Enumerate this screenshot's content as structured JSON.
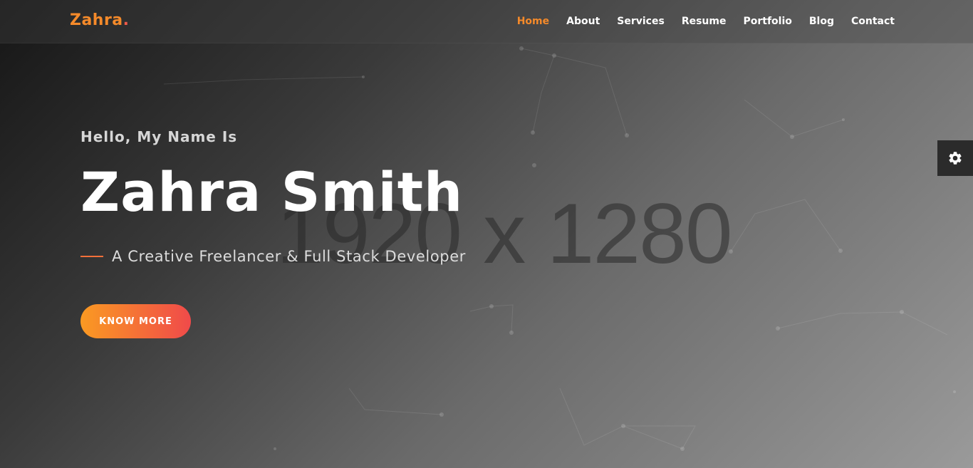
{
  "brand": {
    "name": "Zahra",
    "dot": "."
  },
  "nav": {
    "items": [
      {
        "label": "Home",
        "active": true
      },
      {
        "label": "About",
        "active": false
      },
      {
        "label": "Services",
        "active": false
      },
      {
        "label": "Resume",
        "active": false
      },
      {
        "label": "Portfolio",
        "active": false
      },
      {
        "label": "Blog",
        "active": false
      },
      {
        "label": "Contact",
        "active": false
      }
    ]
  },
  "hero": {
    "greeting": "Hello, My Name Is",
    "name": "Zahra Smith",
    "tagline": "A Creative Freelancer & Full Stack Developer",
    "cta_label": "KNOW MORE",
    "background_placeholder": "1920 x 1280"
  },
  "settings": {
    "icon": "gear-icon"
  },
  "colors": {
    "accent": "#f58a2a",
    "accent_end": "#f04a4a",
    "text": "#ffffff"
  }
}
